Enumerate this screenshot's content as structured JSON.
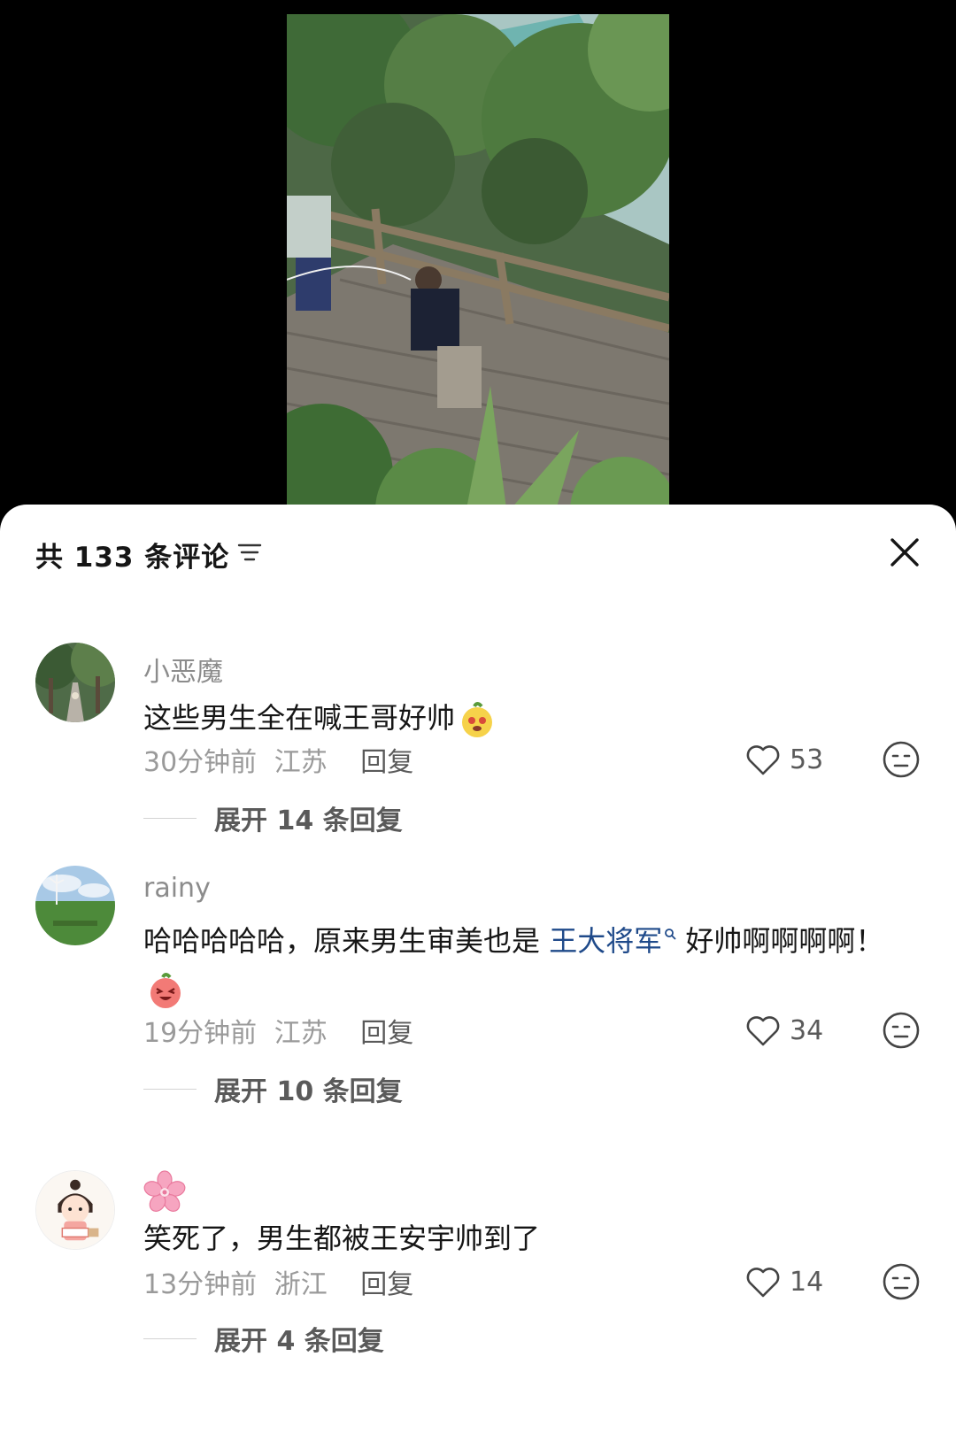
{
  "header": {
    "comment_count": "共 133 条评论",
    "sort_icon": "filter-lines-icon",
    "close_icon": "close-x-icon"
  },
  "comments": [
    {
      "username": "小恶魔",
      "text": "这些男生全在喊王哥好帅",
      "emoji": "pumpkin-face-emoji",
      "time": "30分钟前",
      "location": "江苏",
      "reply_label": "回复",
      "likes": "53",
      "expand_label": "展开 14 条回复"
    },
    {
      "username": "rainy",
      "text_before": "哈哈哈哈哈，原来男生审美也是 ",
      "mention": "王大将军",
      "text_after": " 好帅啊啊啊啊！",
      "emoji": "laughing-face-emoji",
      "time": "19分钟前",
      "location": "江苏",
      "reply_label": "回复",
      "likes": "34",
      "expand_label": "展开 10 条回复"
    },
    {
      "username_icon": "cherry-blossom-emoji",
      "text": "笑死了，男生都被王安宇帅到了",
      "time": "13分钟前",
      "location": "浙江",
      "reply_label": "回复",
      "likes": "14",
      "expand_label": "展开 4 条回复"
    }
  ],
  "icons": {
    "like": "heart-outline-icon",
    "dislike": "neutral-face-icon"
  }
}
